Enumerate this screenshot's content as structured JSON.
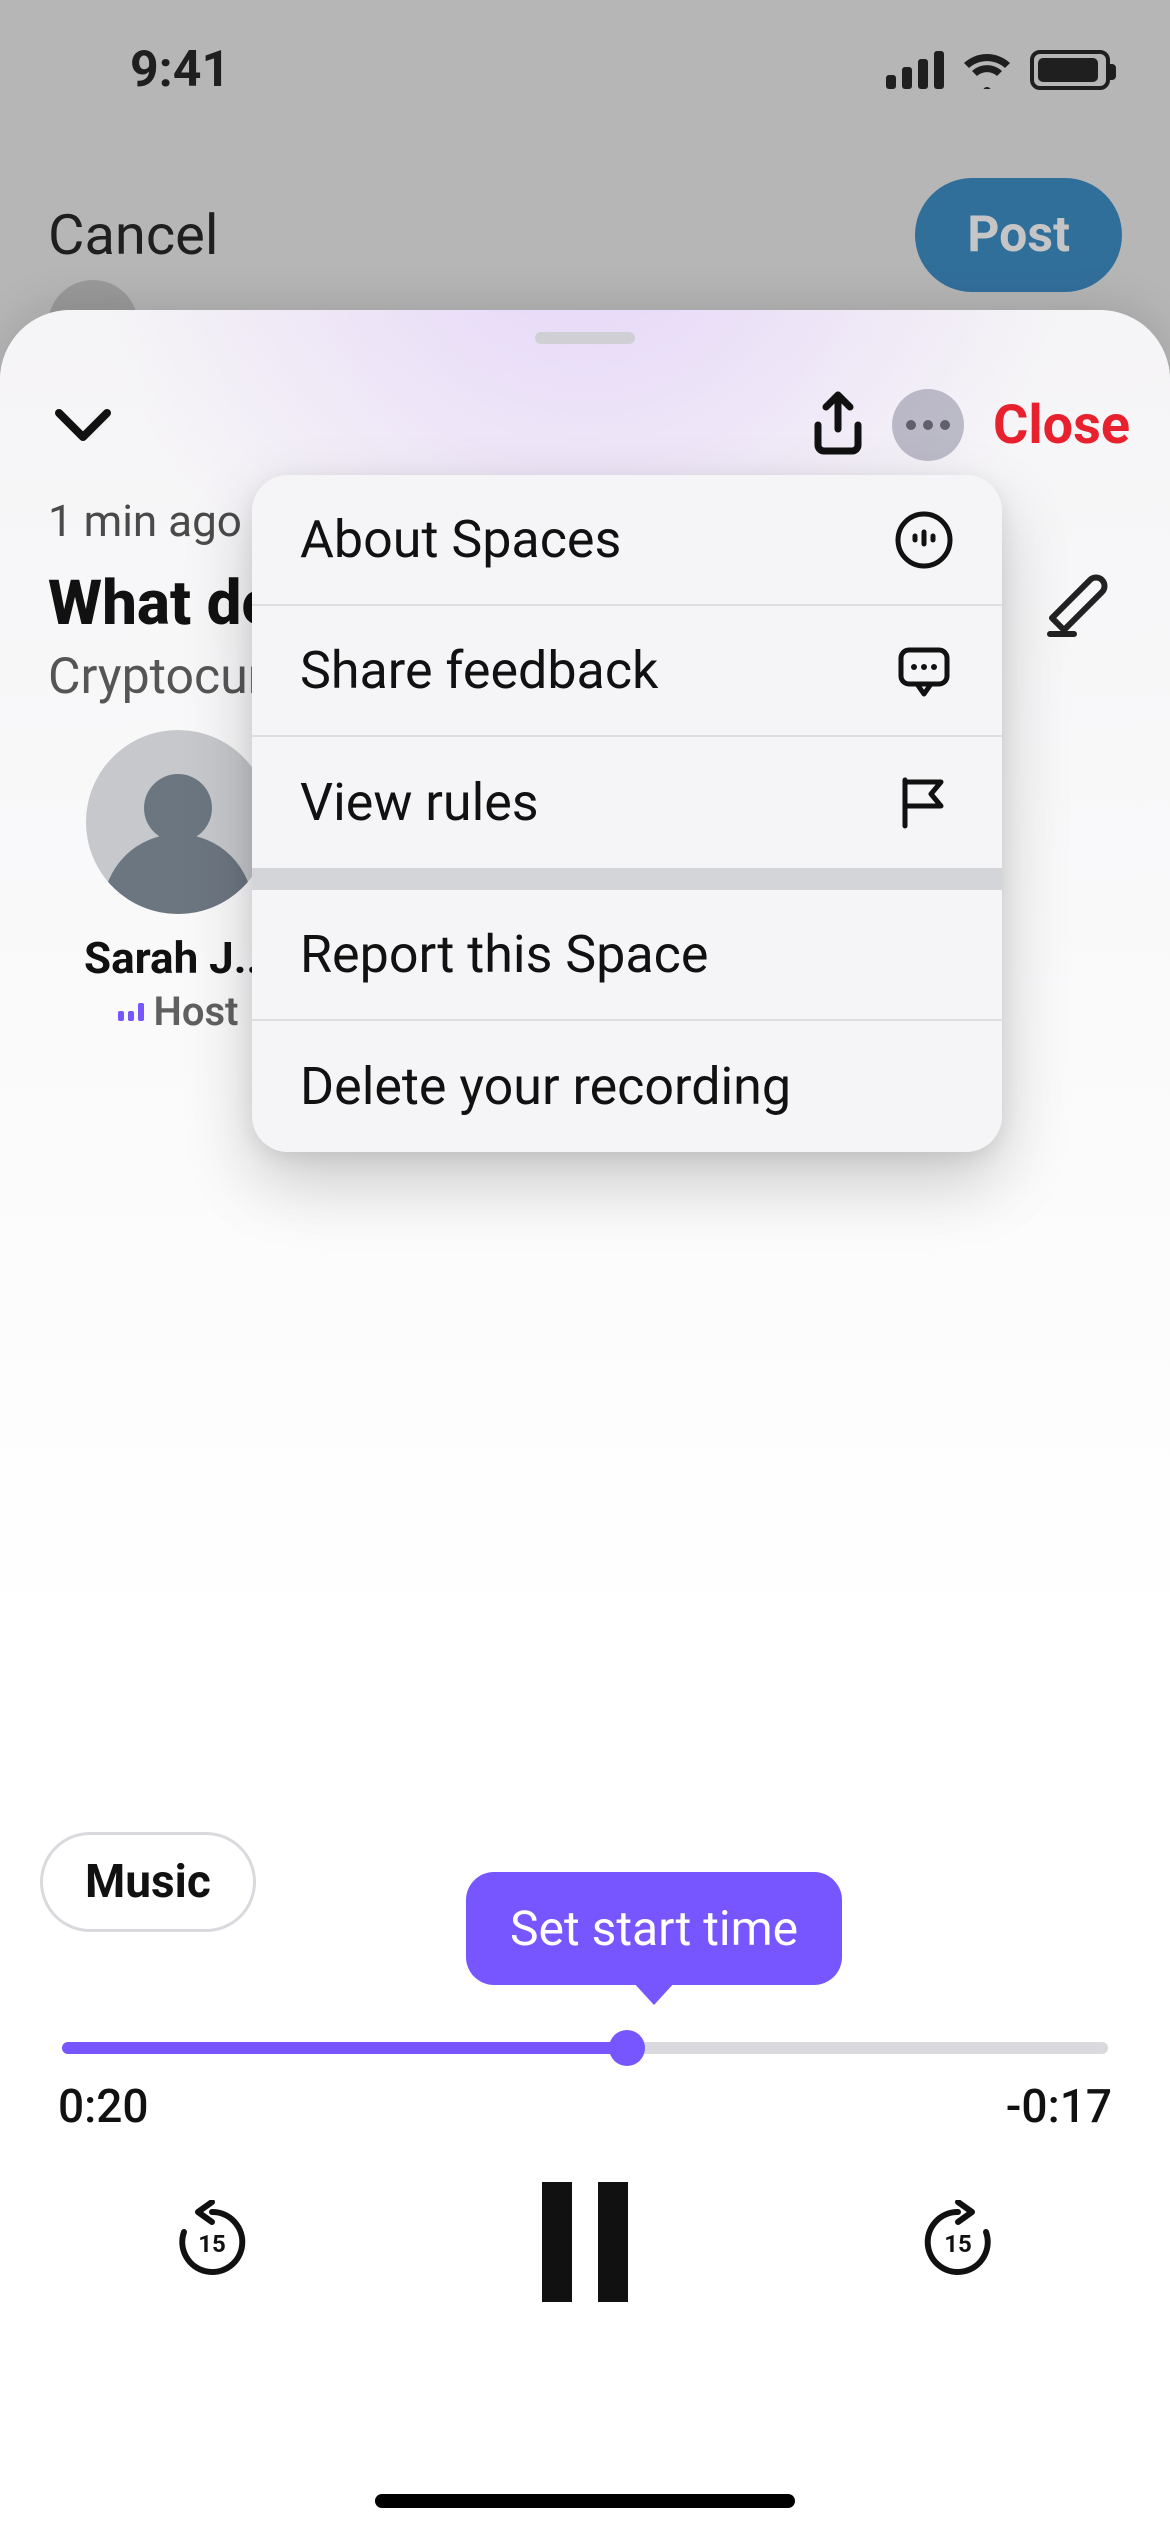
{
  "status_bar": {
    "time": "9:41"
  },
  "compose": {
    "cancel_label": "Cancel",
    "post_label": "Post"
  },
  "sheet": {
    "close_label": "Close",
    "timestamp": "1 min ago",
    "title": "What do",
    "category": "Cryptocur",
    "host": {
      "name": "Sarah J...",
      "role": "Host"
    }
  },
  "menu": {
    "items_group1": [
      {
        "label": "About Spaces",
        "icon": "mic-circle-icon"
      },
      {
        "label": "Share feedback",
        "icon": "chat-icon"
      },
      {
        "label": "View rules",
        "icon": "flag-icon"
      }
    ],
    "items_group2": [
      {
        "label": "Report this Space"
      },
      {
        "label": "Delete your recording"
      }
    ]
  },
  "audio": {
    "music_label": "Music",
    "tooltip_label": "Set start time",
    "elapsed": "0:20",
    "remaining": "-0:17",
    "progress_pct": 54
  },
  "colors": {
    "accent": "#7856ff",
    "post_blue": "#1d7bbf",
    "danger": "#e7222e"
  }
}
